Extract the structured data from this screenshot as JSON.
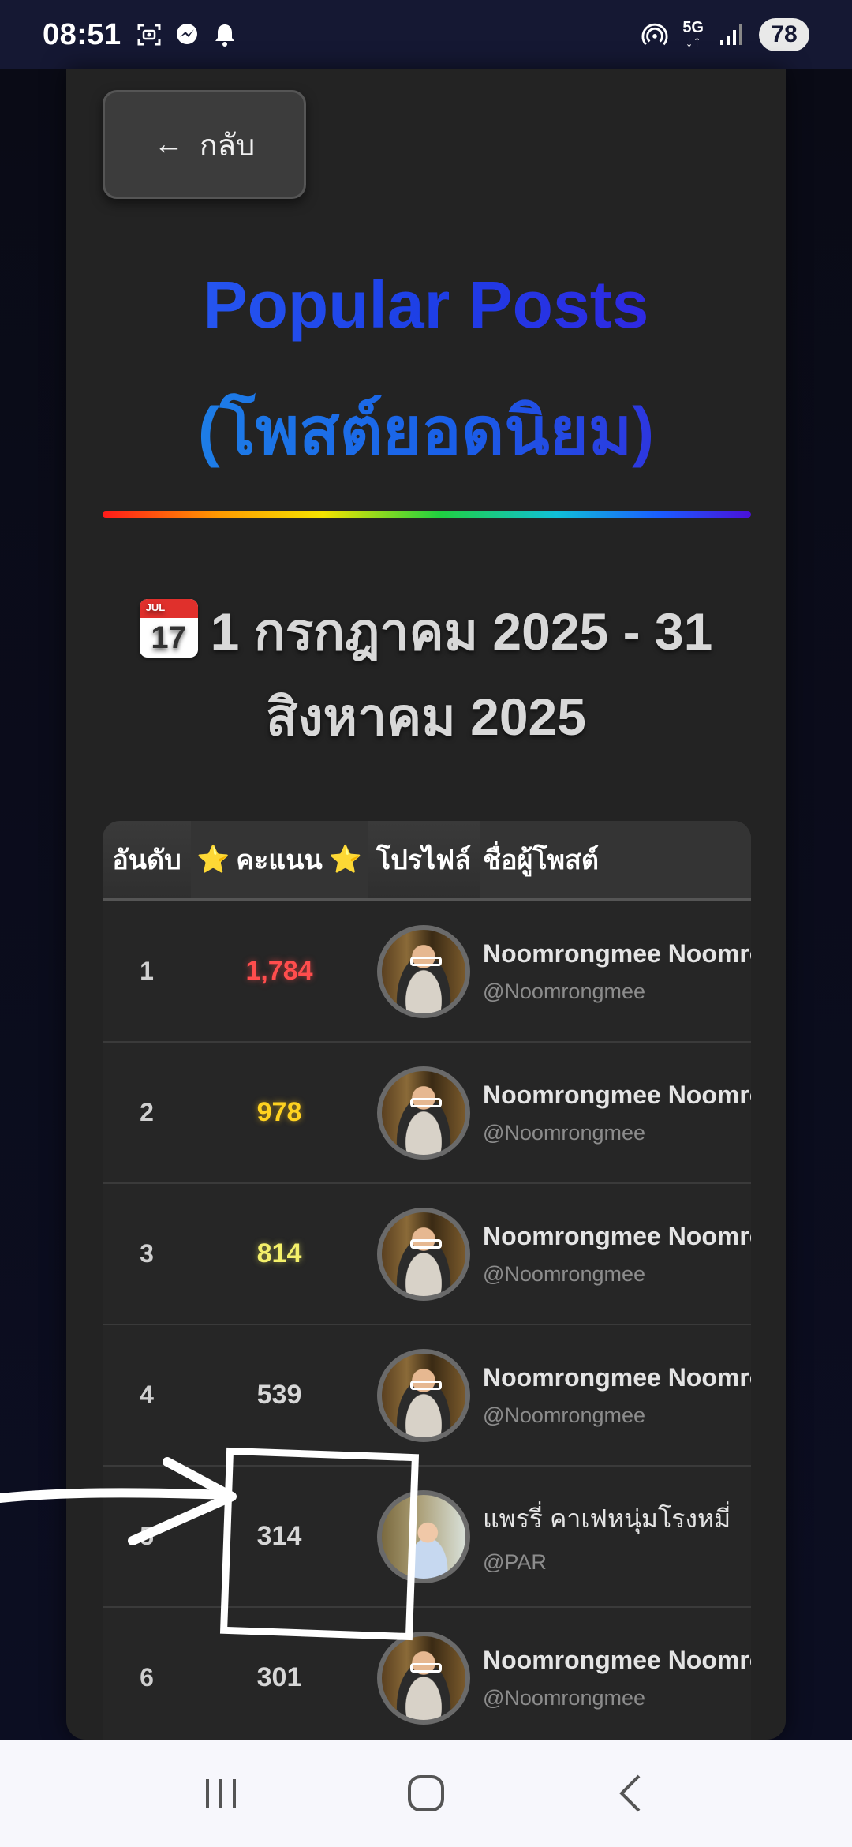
{
  "status_bar": {
    "time": "08:51",
    "network": "5G",
    "battery": "78",
    "icons_left": [
      "screenshot-icon",
      "messenger-icon",
      "bell-icon"
    ],
    "icons_right": [
      "hotspot-icon",
      "network-5g-icon",
      "signal-icon",
      "battery-icon"
    ]
  },
  "back_button": {
    "arrow": "←",
    "label": "กลับ"
  },
  "title": {
    "line1": "Popular Posts",
    "line2": "(โพสต์ยอดนิยม)"
  },
  "date_range": {
    "icon_month": "JUL",
    "icon_day": "17",
    "line1": "1 กรกฎาคม 2025 - 31",
    "line2": "สิงหาคม 2025"
  },
  "table": {
    "headers": {
      "rank": "อันดับ",
      "score_star": "⭐",
      "score": "คะแนน",
      "profile": "โปรไฟล์",
      "name": "ชื่อผู้โพสต์"
    },
    "rows": [
      {
        "rank": "1",
        "score": "1,784",
        "name": "Noomrongmee Noomrongmee",
        "handle": "@Noomrongmee"
      },
      {
        "rank": "2",
        "score": "978",
        "name": "Noomrongmee Noomrongmee",
        "handle": "@Noomrongmee"
      },
      {
        "rank": "3",
        "score": "814",
        "name": "Noomrongmee Noomrongmee",
        "handle": "@Noomrongmee"
      },
      {
        "rank": "4",
        "score": "539",
        "name": "Noomrongmee Noomrongmee",
        "handle": "@Noomrongmee"
      },
      {
        "rank": "5",
        "score": "314",
        "name": "แพรรี่ คาเฟหนุ่มโรงหมี่",
        "handle": "@PAR"
      },
      {
        "rank": "6",
        "score": "301",
        "name": "Noomrongmee Noomrongmee",
        "handle": "@Noomrongmee"
      }
    ]
  },
  "colors": {
    "score_rank1": "#ff4d4d",
    "score_rank2": "#ffd21f",
    "score_rank3": "#f4f06a",
    "annotation": "#ffffff"
  },
  "nav": {
    "icons": [
      "recent-apps-icon",
      "home-icon",
      "back-icon"
    ]
  }
}
